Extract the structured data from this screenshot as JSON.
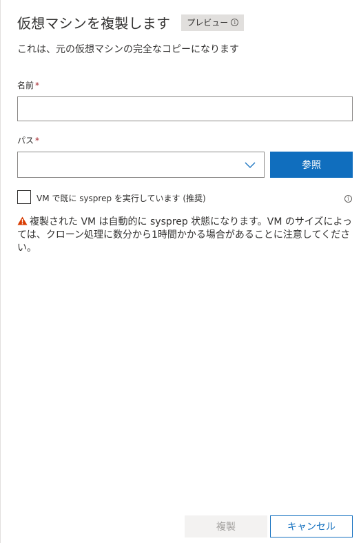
{
  "header": {
    "title": "仮想マシンを複製します",
    "preview_badge": "プレビュー",
    "info_glyph": "i"
  },
  "subtitle": "これは、元の仮想マシンの完全なコピーになります",
  "name_field": {
    "label": "名前",
    "required_mark": "*",
    "value": "",
    "placeholder": ""
  },
  "path_field": {
    "label": "パス",
    "required_mark": "*",
    "selected_value": "",
    "browse_label": "参照"
  },
  "sysprep_checkbox": {
    "label": "VM で既に sysprep を実行しています (推奨)",
    "checked": false,
    "info_glyph": "i"
  },
  "warning": {
    "icon": "warning-icon",
    "text": "複製された VM は自動的に sysprep 状態になります。VM のサイズによっては、クローン処理に数分から1時間かかる場合があることに注意してください。"
  },
  "footer": {
    "clone_label": "複製",
    "cancel_label": "キャンセル"
  },
  "colors": {
    "primary": "#106ebe",
    "required": "#a4262c",
    "warning": "#d83b01",
    "disabled_bg": "#f3f2f1",
    "disabled_text": "#a19f9d",
    "border": "#8a8886"
  }
}
